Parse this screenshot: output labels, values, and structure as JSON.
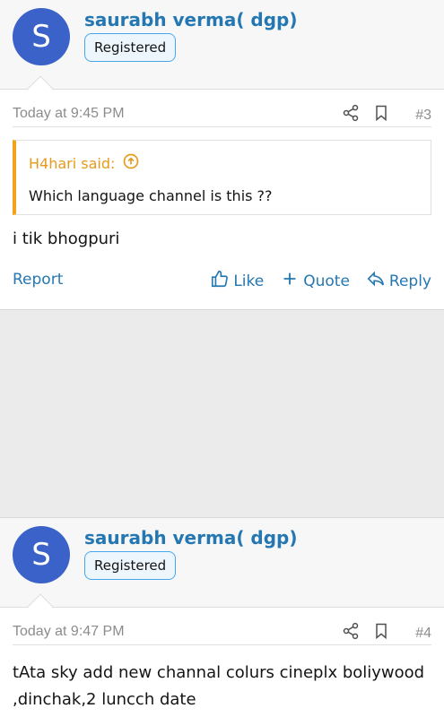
{
  "posts": [
    {
      "author": "saurabh verma( dgp)",
      "avatar_letter": "S",
      "badge": "Registered",
      "timestamp": "Today at 9:45 PM",
      "post_number": "#3",
      "quote": {
        "author": "H4hari said:",
        "text": "Which language channel is this ??"
      },
      "message": "i tik bhogpuri",
      "actions": {
        "report": "Report",
        "like": "Like",
        "quote": "Quote",
        "reply": "Reply"
      }
    },
    {
      "author": "saurabh verma( dgp)",
      "avatar_letter": "S",
      "badge": "Registered",
      "timestamp": "Today at 9:47 PM",
      "post_number": "#4",
      "message": "tAta sky add new channal colurs cineplx boliywood ,dinchak,2 luncch date"
    }
  ],
  "colors": {
    "link": "#2577b1",
    "avatar_bg": "#3a62c8",
    "quote_accent": "#f3a21b",
    "badge_border": "#47a7eb"
  },
  "icons": [
    "share-icon",
    "bookmark-icon",
    "arrow-up-circle-icon",
    "thumbs-up-icon",
    "plus-icon",
    "reply-icon"
  ]
}
